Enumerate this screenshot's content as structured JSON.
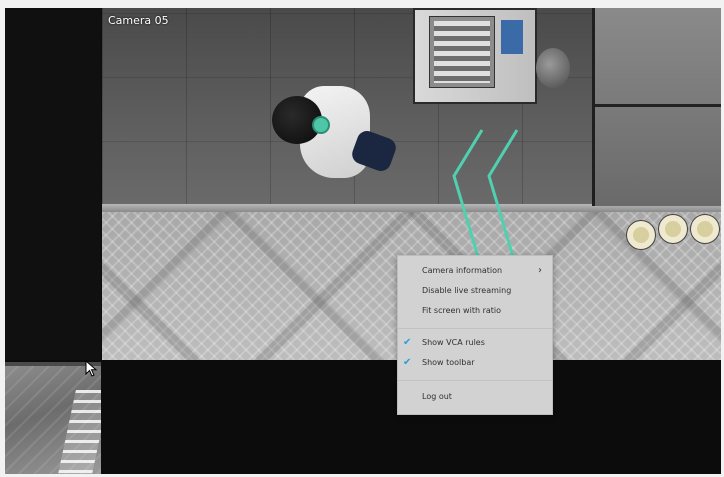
{
  "camera": {
    "label": "Camera 05"
  },
  "context_menu": {
    "items": [
      {
        "label": "Camera information",
        "has_submenu": true,
        "checked": false
      },
      {
        "label": "Disable live streaming",
        "has_submenu": false,
        "checked": false
      },
      {
        "label": "Fit screen with ratio",
        "has_submenu": false,
        "checked": false
      },
      {
        "label": "Show VCA rules",
        "has_submenu": false,
        "checked": true
      },
      {
        "label": "Show toolbar",
        "has_submenu": false,
        "checked": true
      },
      {
        "label": "Log out",
        "has_submenu": false,
        "checked": false
      }
    ],
    "submenu_glyph": "›",
    "check_glyph": "✔"
  },
  "colors": {
    "vca_rule": "#4fd1b0",
    "check": "#2a9fd8",
    "menu_bg": "#d2d2d2"
  },
  "icons": {
    "cursor": "cursor-arrow-icon",
    "check": "checkmark-icon",
    "submenu": "chevron-right-icon"
  }
}
